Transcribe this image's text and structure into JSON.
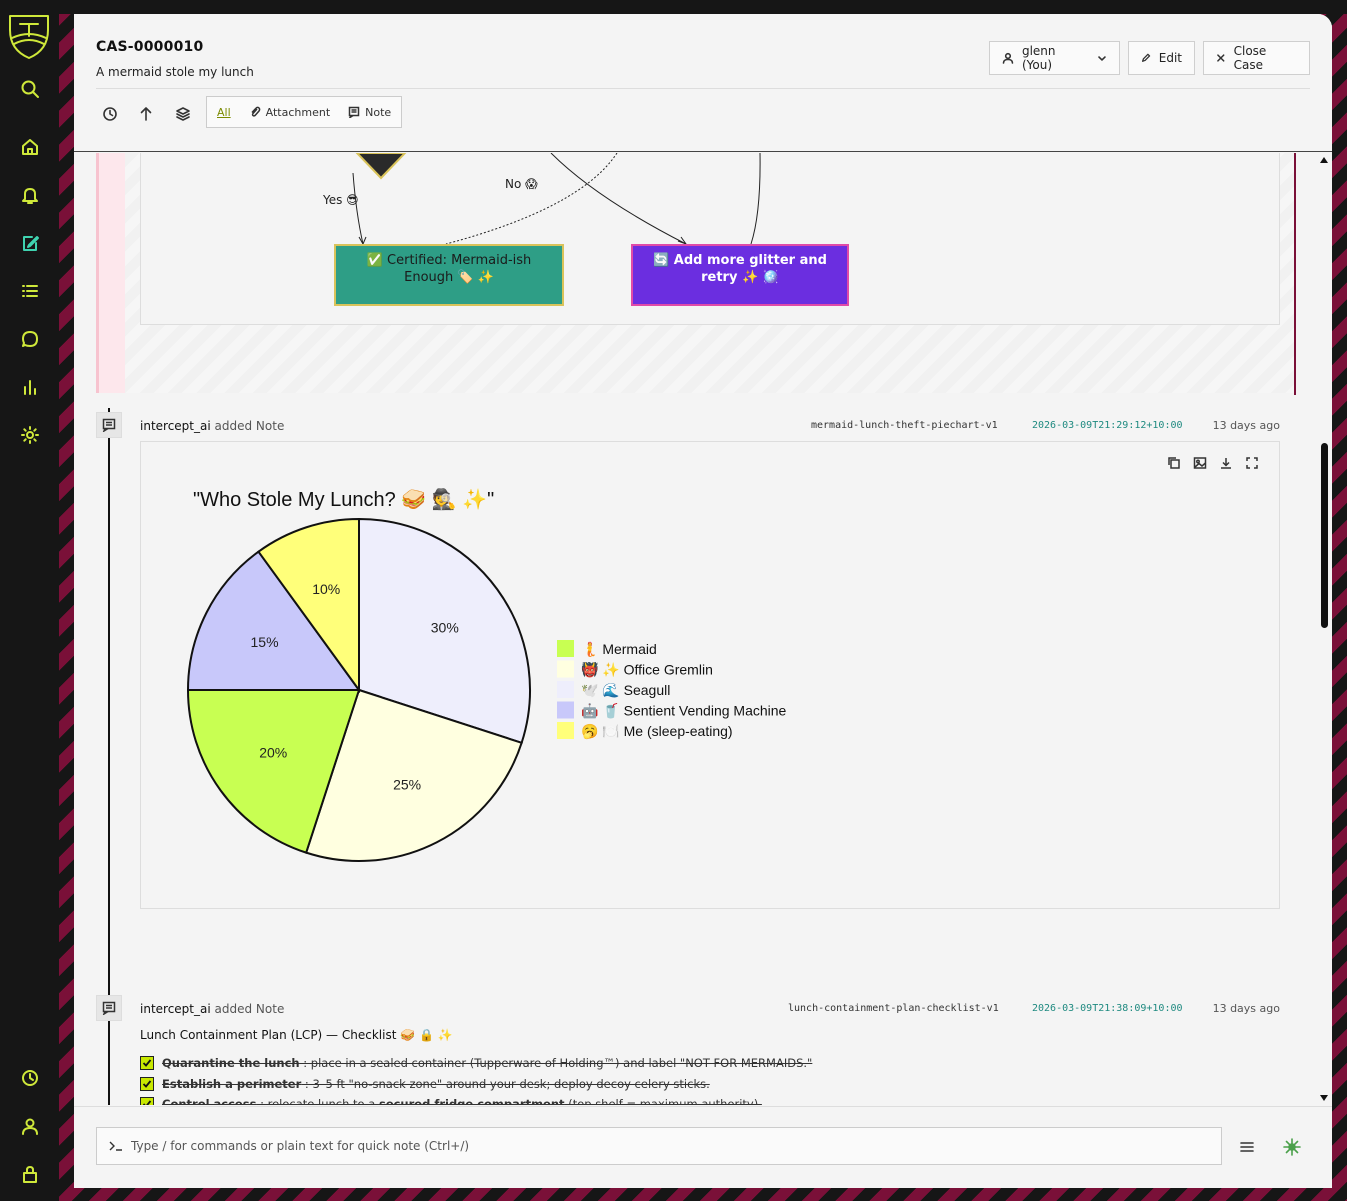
{
  "case": {
    "id": "CAS-0000010",
    "subtitle": "A mermaid stole my lunch"
  },
  "header": {
    "assignee": "glenn (You)",
    "edit": "Edit",
    "close": "Close Case"
  },
  "filters": {
    "all": "All",
    "attachment": "Attachment",
    "note": "Note"
  },
  "flowchart": {
    "yes_label": "Yes 😎",
    "no_label": "No 😱",
    "node_certified": "✅ Certified: Mermaid-ish Enough 🏷️ ✨",
    "node_glitter": "🔄 Add more glitter and retry ✨ 🪩"
  },
  "entries": [
    {
      "author": "intercept_ai",
      "action": "added Note",
      "slug": "mermaid-lunch-theft-piechart-v1",
      "timestamp": "2026-03-09T21:29:12+10:00",
      "ago": "13 days ago"
    },
    {
      "author": "intercept_ai",
      "action": "added Note",
      "slug": "lunch-containment-plan-checklist-v1",
      "timestamp": "2026-03-09T21:38:09+10:00",
      "ago": "13 days ago"
    }
  ],
  "chart_data": {
    "type": "pie",
    "title": "\"Who Stole My Lunch? 🥪 🕵️ ✨\"",
    "categories": [
      "🧜 Mermaid",
      "👹 ✨ Office Gremlin",
      "🕊️ 🌊 Seagull",
      "🤖 🥤 Sentient Vending Machine",
      "🥱 🍽️ Me (sleep-eating)"
    ],
    "values": [
      20,
      25,
      30,
      15,
      10
    ],
    "labels": [
      "20%",
      "25%",
      "30%",
      "15%",
      "10%"
    ],
    "colors": [
      "#c8ff52",
      "#ffffe0",
      "#eeeefc",
      "#c8c8fa",
      "#ffff7a"
    ],
    "legend_position": "right"
  },
  "checklist": {
    "title": "Lunch Containment Plan (LCP) — Checklist 🥪 🔒 ✨",
    "items": [
      {
        "bold": "Quarantine the lunch",
        "rest": " : place in a sealed container (Tupperware of Holding™) and label \"NOT FOR MERMAIDS.\""
      },
      {
        "bold": "Establish a perimeter",
        "rest": " : 3–5 ft \"no-snack zone\" around your desk; deploy decoy celery sticks."
      },
      {
        "bold": "Control access",
        "rest": " : relocate lunch to a ",
        "bold2": "secured fridge compartment",
        "rest2": " (top shelf = maximum authority)."
      }
    ]
  },
  "composer": {
    "placeholder": "Type / for commands or plain text for quick note (Ctrl+/)"
  }
}
